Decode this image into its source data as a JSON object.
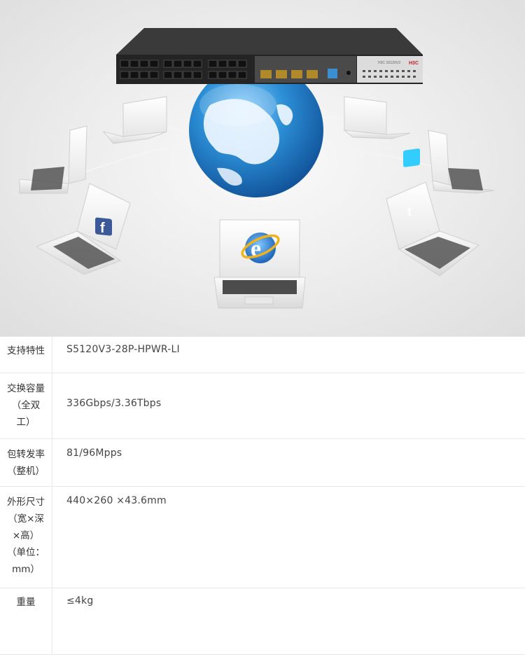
{
  "switch": {
    "brand": "H3C",
    "model_text": "H3C S5120V3"
  },
  "logos": {
    "facebook": "facebook-icon",
    "browser": "internet-explorer-icon",
    "twitter": "twitter-icon"
  },
  "specs": [
    {
      "label": "支持特性",
      "value": "S5120V3-28P-HPWR-LI"
    },
    {
      "label": "交换容量\n（全双\n工）",
      "value": "336Gbps/3.36Tbps"
    },
    {
      "label": "包转发率\n（整机）",
      "value": "81/96Mpps"
    },
    {
      "label": "外形尺寸\n（宽×深\n×高）\n（单位：\nmm）",
      "value": "440×260 ×43.6mm"
    },
    {
      "label": "重量",
      "value": "≤4kg"
    }
  ],
  "colors": {
    "switch_body": "#2a2a2a",
    "globe": "#2c8fd6",
    "ie_blue": "#2b7fd4",
    "ie_ring": "#f2b21c",
    "facebook": "#3b5998",
    "twitter": "#33ccff"
  }
}
